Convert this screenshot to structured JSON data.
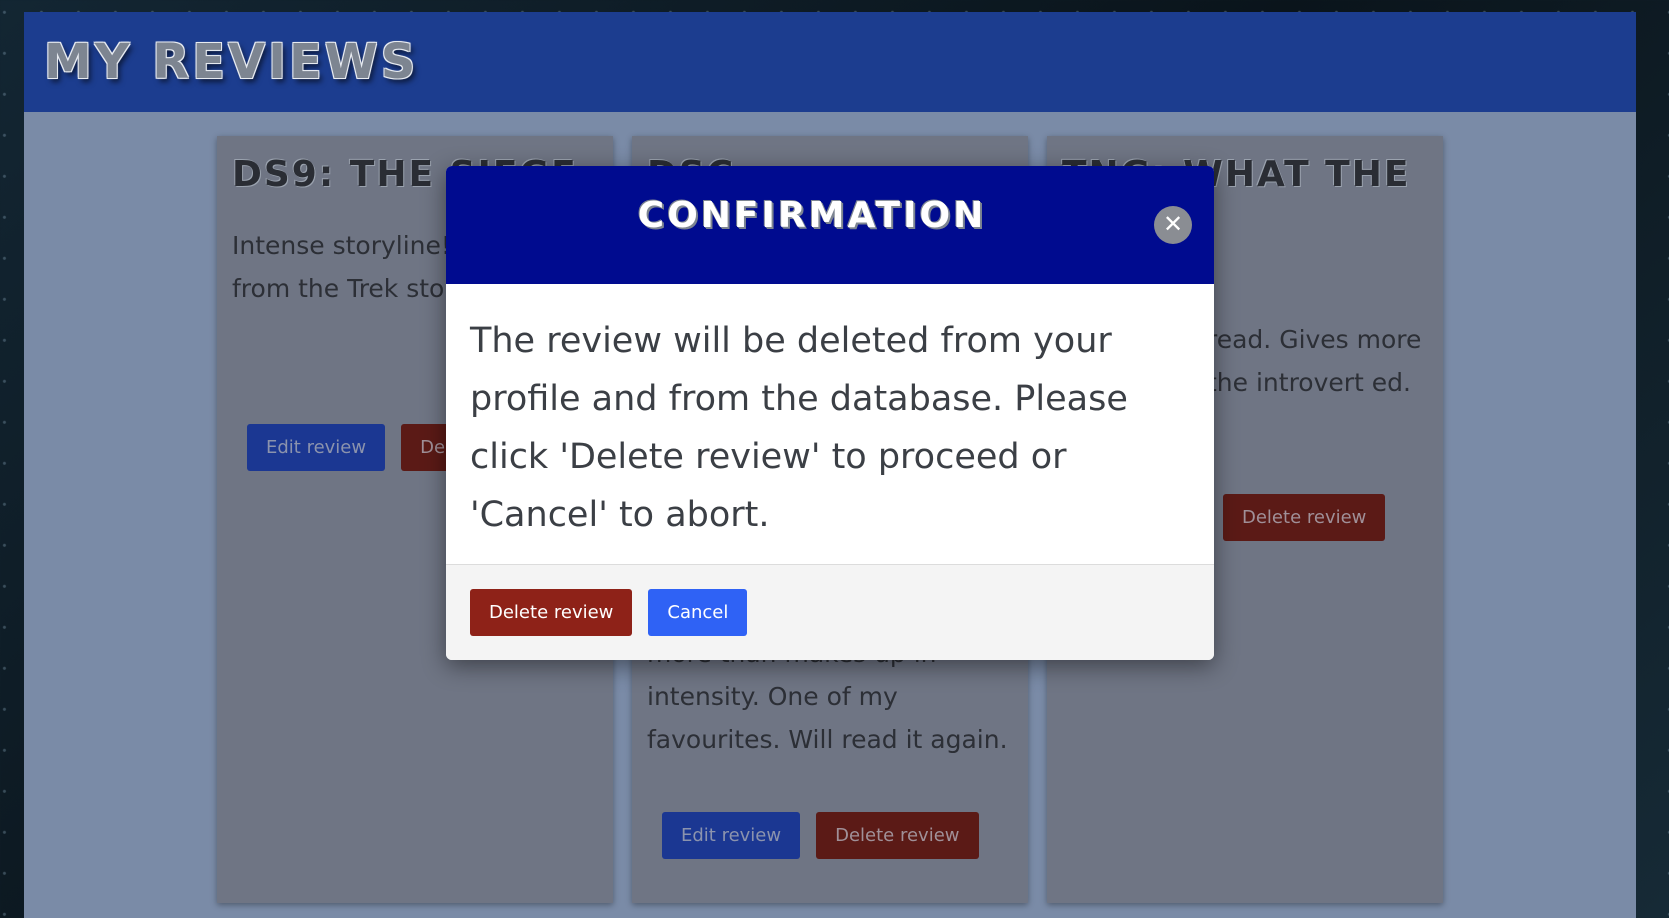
{
  "page": {
    "title": "MY REVIEWS"
  },
  "cards": [
    {
      "title": "DS9: THE SIEGE",
      "text": "Intense storyline! change from the Trek stories.",
      "edit_label": "Edit review",
      "delete_label": "Delete review"
    },
    {
      "title": "DSC",
      "text": "more than makes up in intensity. One of my favourites. Will read it again.",
      "edit_label": "Edit review",
      "delete_label": "Delete review"
    },
    {
      "title": "TNG: WHAT THE SEER?",
      "text": "read. Gives more the introvert ed.",
      "delete_label": "Delete review"
    }
  ],
  "modal": {
    "title": "CONFIRMATION",
    "close_icon": "close-icon",
    "message": "The review will be deleted from your profile and from the database. Please click 'Delete review' to proceed or 'Cancel' to abort.",
    "delete_label": "Delete review",
    "cancel_label": "Cancel"
  },
  "colors": {
    "header": "#1c3d8f",
    "modal_header": "#000b8f",
    "delete": "#8e2218",
    "cancel": "#2f62f5"
  }
}
